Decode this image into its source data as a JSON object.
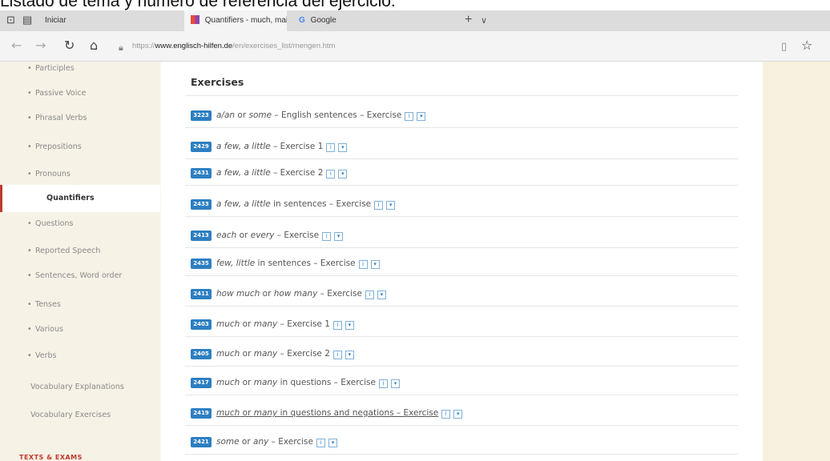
{
  "caption": "Listado de tema y número de referencia del ejercicio.",
  "tabs": [
    {
      "label": "Iniciar",
      "active": false
    },
    {
      "label": "Quantifiers - much, mai",
      "active": true
    },
    {
      "label": "Google",
      "active": false
    }
  ],
  "address": {
    "prefix": "https://",
    "host": "www.englisch-hilfen.de",
    "path": "/en/exercises_list/mengen.htm"
  },
  "icons": {
    "back": "back-arrow-icon",
    "forward": "forward-arrow-icon",
    "refresh": "refresh-icon",
    "home": "home-icon",
    "lock": "lock-icon",
    "reading": "reading-view-icon",
    "favorite": "favorite-star-icon"
  },
  "sidebar": {
    "items": [
      {
        "label": "Participles",
        "bullet": "•"
      },
      {
        "label": "Passive Voice",
        "bullet": "•"
      },
      {
        "label": "Phrasal Verbs",
        "bullet": "•"
      },
      {
        "label": "Prepositions",
        "bullet": "•"
      },
      {
        "label": "Pronouns",
        "bullet": "•"
      },
      {
        "label": "Quantifiers",
        "bullet": "",
        "active": true
      },
      {
        "label": "Questions",
        "bullet": "•"
      },
      {
        "label": "Reported Speech",
        "bullet": "•"
      },
      {
        "label": "Sentences, Word order",
        "bullet": "•"
      },
      {
        "label": "Tenses",
        "bullet": "•"
      },
      {
        "label": "Various",
        "bullet": "•"
      },
      {
        "label": "Verbs",
        "bullet": "•"
      },
      {
        "label": "Vocabulary Explanations",
        "bullet": ""
      },
      {
        "label": "Vocabulary Exercises",
        "bullet": ""
      }
    ],
    "section_heading": "TEXTS & EXAMS"
  },
  "main": {
    "heading": "Exercises",
    "exercises": [
      {
        "id": "3223",
        "italic": "a/an",
        "rest_mid": " or ",
        "italic2": "some",
        "tail": " – English sentences – Exercise"
      },
      {
        "id": "2429",
        "italic": "a few, a little",
        "rest_mid": "",
        "italic2": "",
        "tail": " – Exercise 1"
      },
      {
        "id": "2431",
        "italic": "a few, a little",
        "rest_mid": "",
        "italic2": "",
        "tail": " – Exercise 2"
      },
      {
        "id": "2433",
        "italic": "a few, a little",
        "rest_mid": "",
        "italic2": "",
        "tail": " in sentences – Exercise"
      },
      {
        "id": "2413",
        "italic": "each",
        "rest_mid": " or ",
        "italic2": "every",
        "tail": " – Exercise"
      },
      {
        "id": "2435",
        "italic": "few, little",
        "rest_mid": "",
        "italic2": "",
        "tail": " in sentences – Exercise"
      },
      {
        "id": "2411",
        "italic": "how much",
        "rest_mid": " or ",
        "italic2": "how many",
        "tail": " – Exercise"
      },
      {
        "id": "2403",
        "italic": "much",
        "rest_mid": " or ",
        "italic2": "many",
        "tail": " – Exercise 1"
      },
      {
        "id": "2405",
        "italic": "much",
        "rest_mid": " or ",
        "italic2": "many",
        "tail": " – Exercise 2"
      },
      {
        "id": "2417",
        "italic": "much",
        "rest_mid": " or ",
        "italic2": "many",
        "tail": " in questions – Exercise"
      },
      {
        "id": "2419",
        "italic": "much",
        "rest_mid": " or ",
        "italic2": "many",
        "tail": " in questions and negations – Exercise",
        "underlined": true
      },
      {
        "id": "2421",
        "italic": "some",
        "rest_mid": " or ",
        "italic2": "any",
        "tail": " – Exercise"
      }
    ],
    "mini_icons": [
      "i",
      "▾"
    ]
  }
}
